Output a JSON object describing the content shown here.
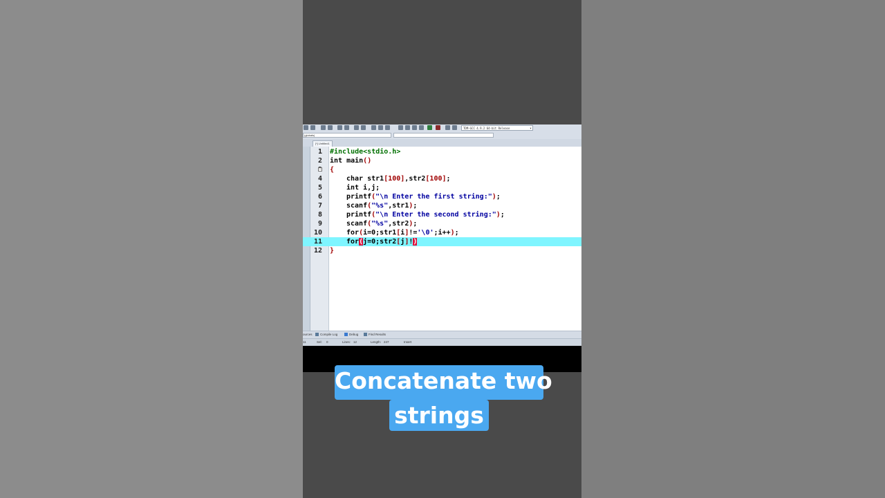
{
  "toolbar": {
    "compiler": "TDM-GCC 4.9.2 64-bit Release",
    "class_combo": "(globals)",
    "member_combo": ""
  },
  "editor": {
    "tab_label": "[*] Untitled1",
    "lines": [
      {
        "num": "1",
        "text": "#include<stdio.h>"
      },
      {
        "num": "2",
        "text": "int main()"
      },
      {
        "num": "3",
        "text": "{"
      },
      {
        "num": "4",
        "text": "char str1[100],str2[100];"
      },
      {
        "num": "5",
        "text": "int i,j;"
      },
      {
        "num": "6",
        "text": "printf(\"\\n Enter the first string:\");"
      },
      {
        "num": "7",
        "text": "scanf(\"%s\",str1);"
      },
      {
        "num": "8",
        "text": "printf(\"\\n Enter the second string:\");"
      },
      {
        "num": "9",
        "text": "scanf(\"%s\",str2);"
      },
      {
        "num": "10",
        "text": "for(i=0;str1[i]!='\\0';i++);"
      },
      {
        "num": "11",
        "text": "for(j=0;str2[j]!)"
      },
      {
        "num": "12",
        "text": "}"
      }
    ],
    "fold_marker": "−"
  },
  "bottom_tabs": {
    "resources": "ources",
    "compile_log": "Compile Log",
    "debug": "Debug",
    "find_results": "Find Results"
  },
  "status": {
    "line": "11",
    "sel_label": "Sel:",
    "sel_value": "0",
    "lines_label": "Lines:",
    "lines_value": "12",
    "length_label": "Length:",
    "length_value": "247",
    "mode": "Insert"
  },
  "caption": {
    "line1": "Concatenate two",
    "line2": "strings"
  },
  "colors": {
    "highlight_line": "#7ff5ff",
    "caption_bg": "#4aa8f0",
    "preprocessor": "#008000",
    "keyword": "#000000",
    "string": "#0000a0",
    "number": "#a00000",
    "bracket": "#a00000"
  }
}
